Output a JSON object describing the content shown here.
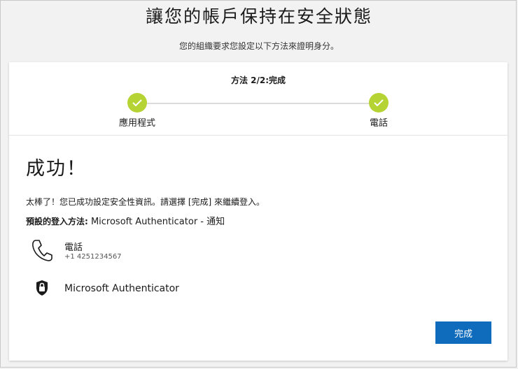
{
  "header": {
    "title": "讓您的帳戶保持在安全狀態",
    "subtitle": "您的組織要求您設定以下方法來證明身分。"
  },
  "progress": {
    "step_label": "方法 2/2:完成",
    "steps": [
      {
        "label": "應用程式",
        "status": "completed"
      },
      {
        "label": "電話",
        "status": "completed"
      }
    ],
    "complete_color": "#b6d334"
  },
  "content": {
    "heading": "成功！",
    "message": "太棒了！您已成功設定安全性資訊。請選擇 [完成] 來繼續登入。",
    "default_method_label": "預設的登入方法:",
    "default_method_value": " Microsoft Authenticator - 通知",
    "methods": [
      {
        "icon": "phone-icon",
        "name": "電話",
        "detail": "+1 4251234567"
      },
      {
        "icon": "authenticator-lock-icon",
        "name": "Microsoft Authenticator"
      }
    ]
  },
  "actions": {
    "done_label": "完成",
    "accent_color": "#0f6cbd"
  }
}
